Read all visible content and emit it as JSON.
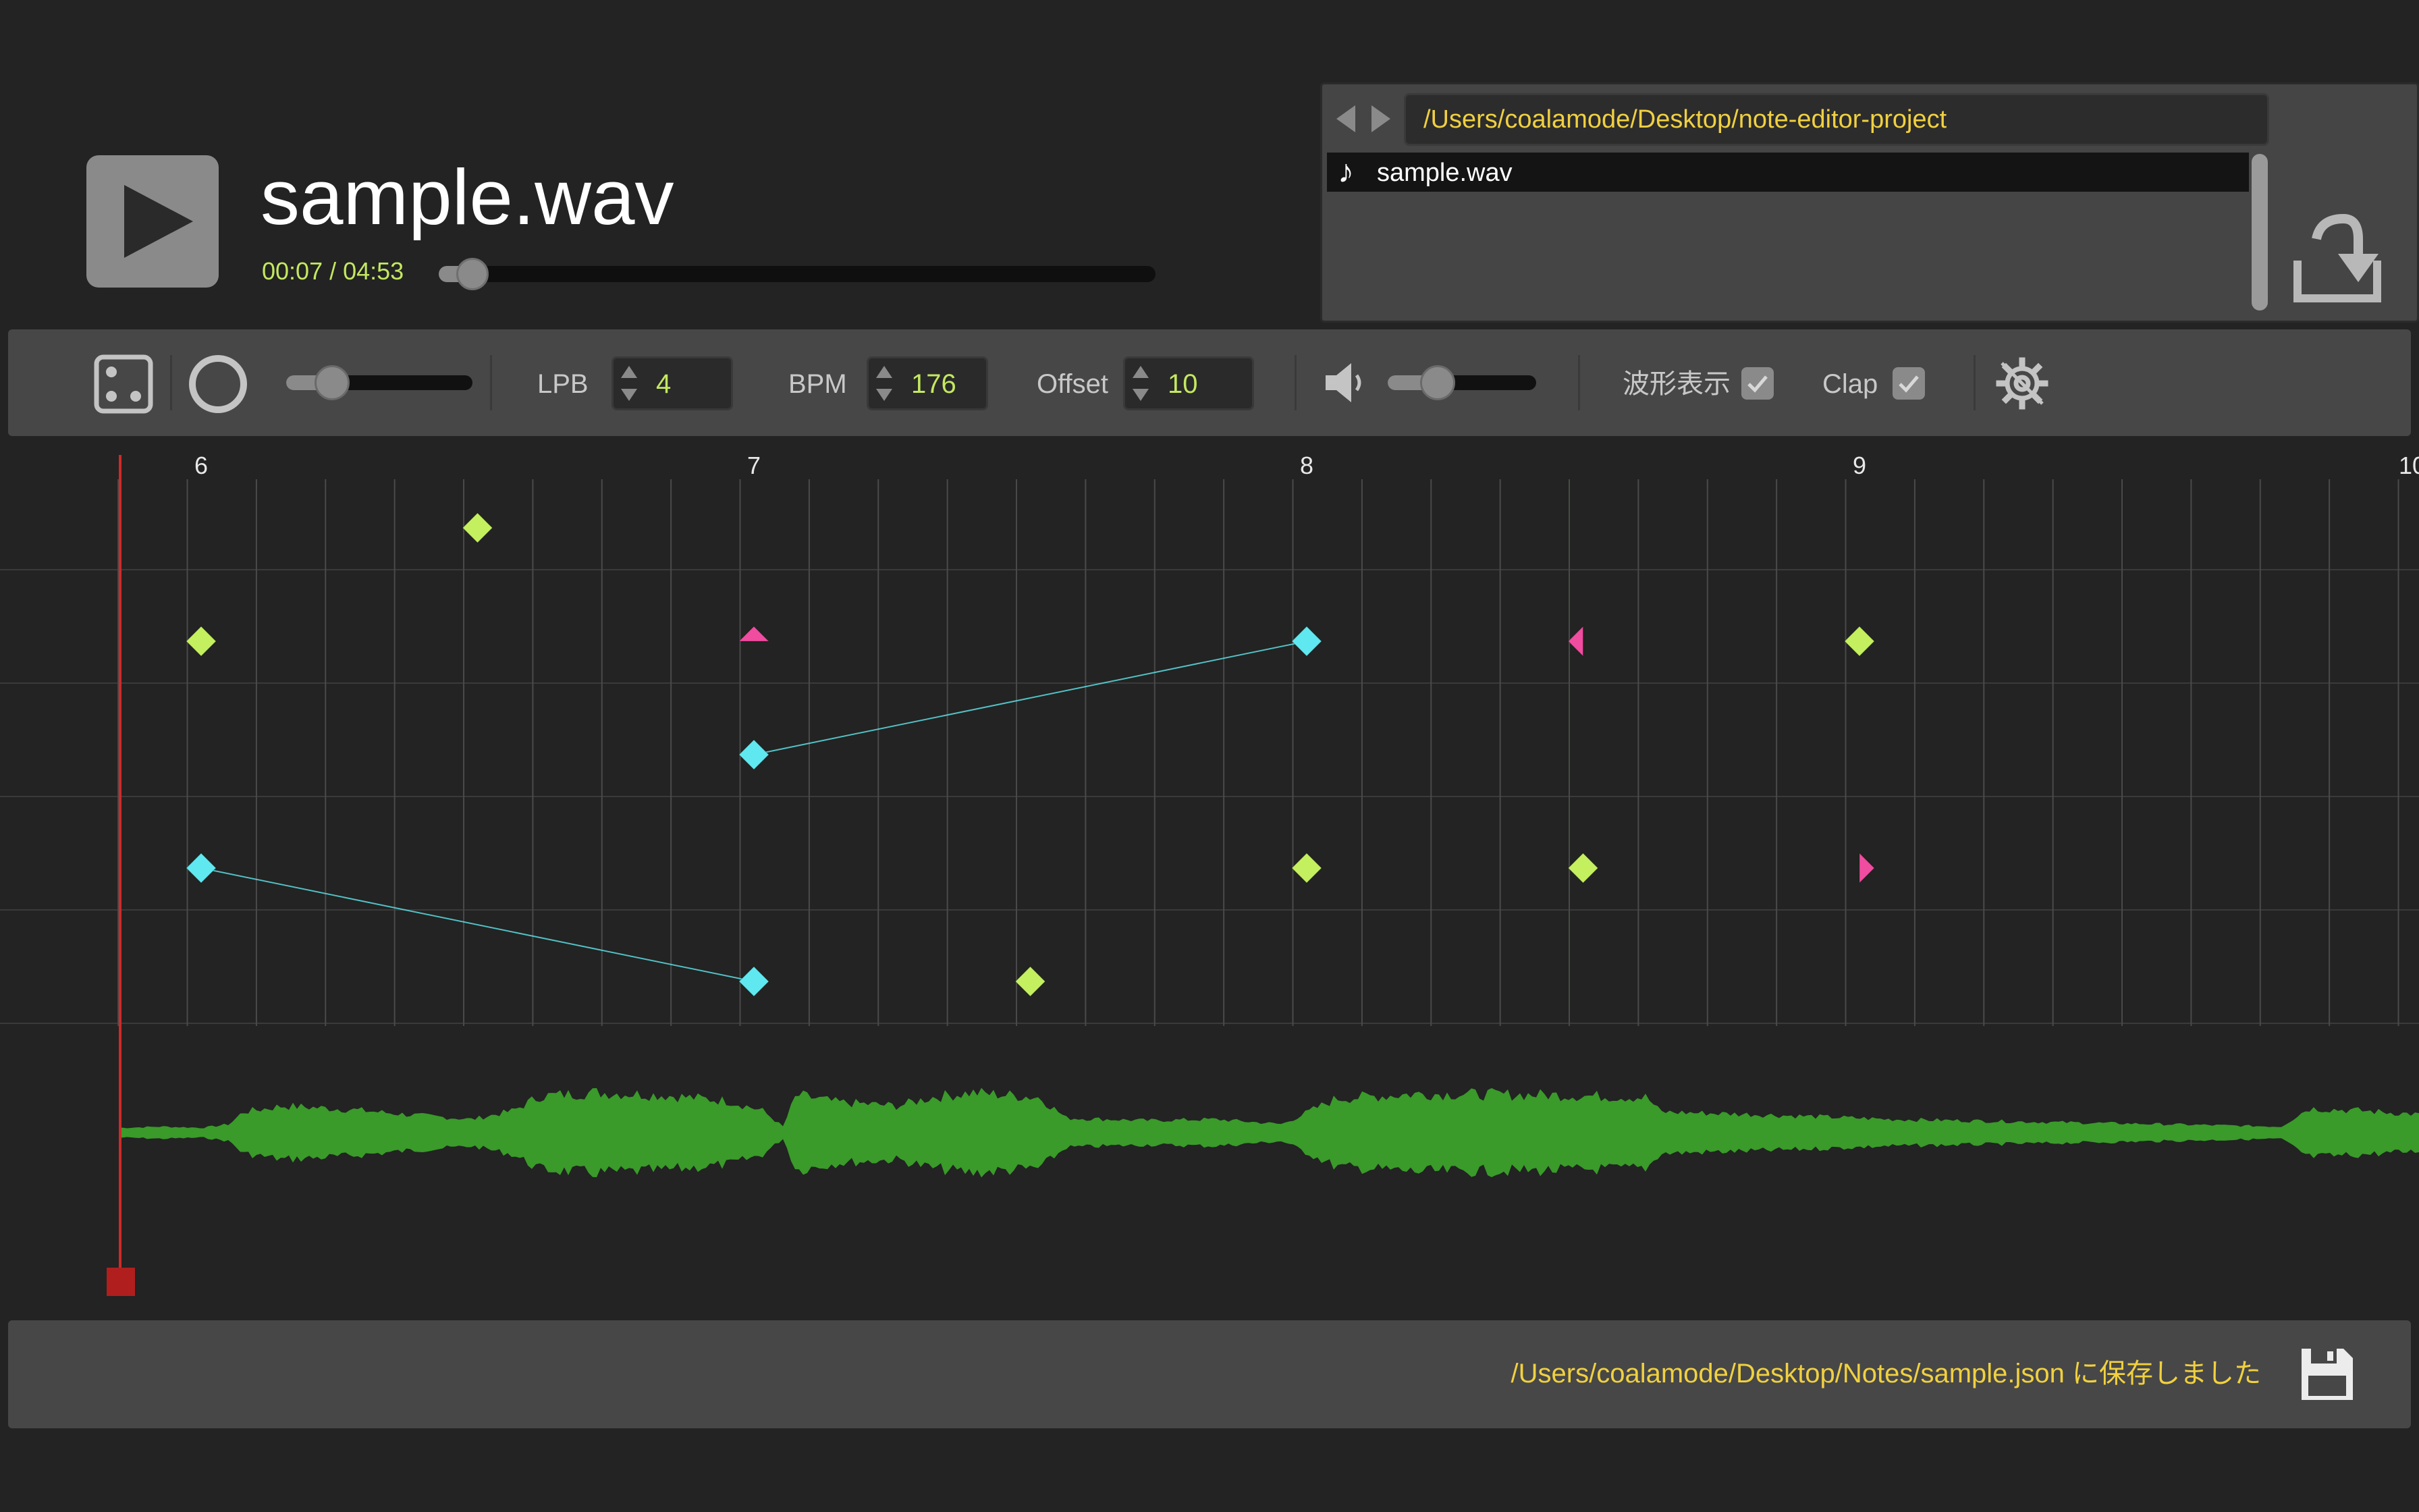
{
  "player": {
    "play_icon": "play-icon",
    "title": "sample.wav",
    "time": "00:07 / 04:53",
    "progress": 0.024
  },
  "browser": {
    "path": "/Users/coalamode/Desktop/note-editor-project",
    "back_icon": "triangle-left-icon",
    "forward_icon": "triangle-right-icon",
    "files": [
      {
        "icon": "music-note-icon",
        "name": "sample.wav",
        "selected": true
      }
    ],
    "import_icon": "import-icon"
  },
  "toolbar": {
    "dice_icon": "dice-icon",
    "circle_icon": "circle-icon",
    "zoom_level": 0.25,
    "lpb_label": "LPB",
    "lpb_value": "4",
    "bpm_label": "BPM",
    "bpm_value": "176",
    "offset_label": "Offset",
    "offset_value": "10",
    "volume_icon": "speaker-icon",
    "volume_level": 0.33,
    "waveform_label": "波形表示",
    "waveform_checked": true,
    "clap_label": "Clap",
    "clap_checked": true,
    "settings_icon": "gear-icon"
  },
  "editor": {
    "beat_labels": [
      "6",
      "7",
      "8",
      "9",
      "10"
    ],
    "lanes": 5,
    "notes": [
      {
        "beat": 6.5,
        "lane": 0,
        "kind": "single"
      },
      {
        "beat": 6.0,
        "lane": 1,
        "kind": "single"
      },
      {
        "beat": 7.0,
        "lane": 1,
        "kind": "flick-up"
      },
      {
        "beat": 8.0,
        "lane": 1,
        "kind": "long"
      },
      {
        "beat": 8.5,
        "lane": 1,
        "kind": "flick-left"
      },
      {
        "beat": 9.0,
        "lane": 1,
        "kind": "single"
      },
      {
        "beat": 7.0,
        "lane": 2,
        "kind": "long"
      },
      {
        "beat": 6.0,
        "lane": 3,
        "kind": "long"
      },
      {
        "beat": 8.0,
        "lane": 3,
        "kind": "single"
      },
      {
        "beat": 8.5,
        "lane": 3,
        "kind": "single"
      },
      {
        "beat": 9.0,
        "lane": 3,
        "kind": "flick-right"
      },
      {
        "beat": 7.0,
        "lane": 4,
        "kind": "long"
      },
      {
        "beat": 7.5,
        "lane": 4,
        "kind": "single"
      }
    ],
    "long_links": [
      {
        "from": {
          "beat": 7.0,
          "lane": 2
        },
        "to": {
          "beat": 8.0,
          "lane": 1
        }
      },
      {
        "from": {
          "beat": 6.0,
          "lane": 3
        },
        "to": {
          "beat": 7.0,
          "lane": 4
        }
      }
    ],
    "colors": {
      "single": "#c4f060",
      "long": "#60e8f0",
      "flick": "#f04ca0",
      "beat_line": "#b8c84a",
      "grid": "#4a4a4a",
      "waveform": "#3a9a2a",
      "playhead": "#d02a2a"
    }
  },
  "status": {
    "message": "/Users/coalamode/Desktop/Notes/sample.json に保存しました",
    "save_icon": "floppy-disk-icon"
  }
}
